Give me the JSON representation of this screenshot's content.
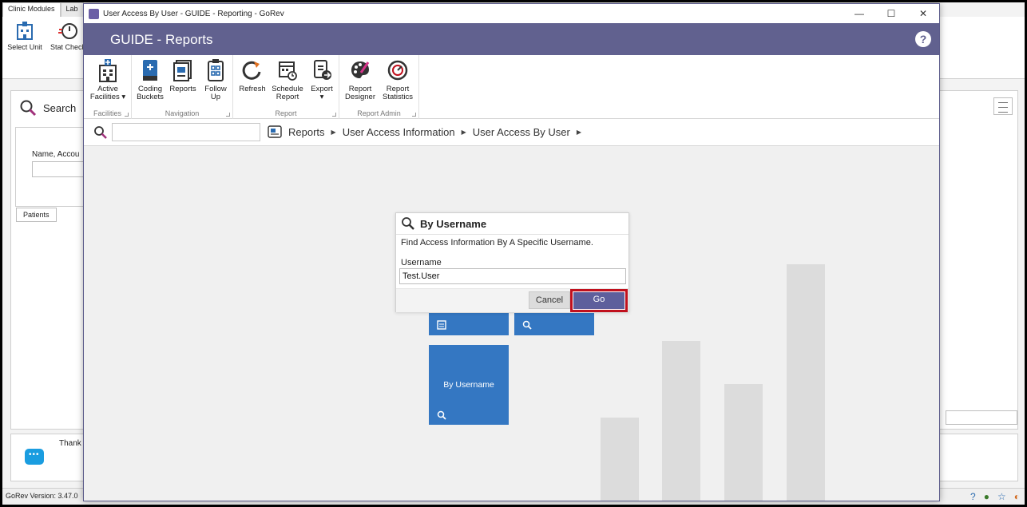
{
  "background_app": {
    "tabs": [
      "Clinic Modules",
      "Lab"
    ],
    "buttons": [
      "Select Unit",
      "Stat Check"
    ],
    "search_title": "Search",
    "search_field_label": "Name, Accou",
    "patients_tab": "Patients",
    "thanks_text": "Thank",
    "version": "GoRev Version: 3.47.0"
  },
  "window": {
    "title": "User Access By User - GUIDE - Reporting - GoRev",
    "header_title": "GUIDE - Reports",
    "help": "?",
    "controls": {
      "minimize": "—",
      "maximize": "☐",
      "close": "✕"
    }
  },
  "ribbon": {
    "groups": [
      {
        "label": "Facilities",
        "buttons": [
          {
            "l1": "Active",
            "l2": "Facilities ▾"
          }
        ]
      },
      {
        "label": "Navigation",
        "buttons": [
          {
            "l1": "Coding",
            "l2": "Buckets"
          },
          {
            "l1": "Reports",
            "l2": ""
          },
          {
            "l1": "Follow",
            "l2": "Up"
          }
        ]
      },
      {
        "label": "Report",
        "buttons": [
          {
            "l1": "Refresh",
            "l2": ""
          },
          {
            "l1": "Schedule",
            "l2": "Report"
          },
          {
            "l1": "Export",
            "l2": "▾"
          }
        ]
      },
      {
        "label": "Report Admin",
        "buttons": [
          {
            "l1": "Report",
            "l2": "Designer"
          },
          {
            "l1": "Report",
            "l2": "Statistics"
          }
        ]
      }
    ]
  },
  "breadcrumb": [
    "Reports",
    "User Access Information",
    "User Access By User"
  ],
  "tile": {
    "label": "By Username"
  },
  "dialog": {
    "title": "By Username",
    "description": "Find Access Information By A Specific Username.",
    "field_label": "Username",
    "field_value": "Test.User",
    "cancel": "Cancel",
    "go": "Go"
  },
  "colors": {
    "header": "#61618f",
    "tile": "#3477c2",
    "go_button": "#5e5f9c",
    "highlight": "#c0101d"
  }
}
